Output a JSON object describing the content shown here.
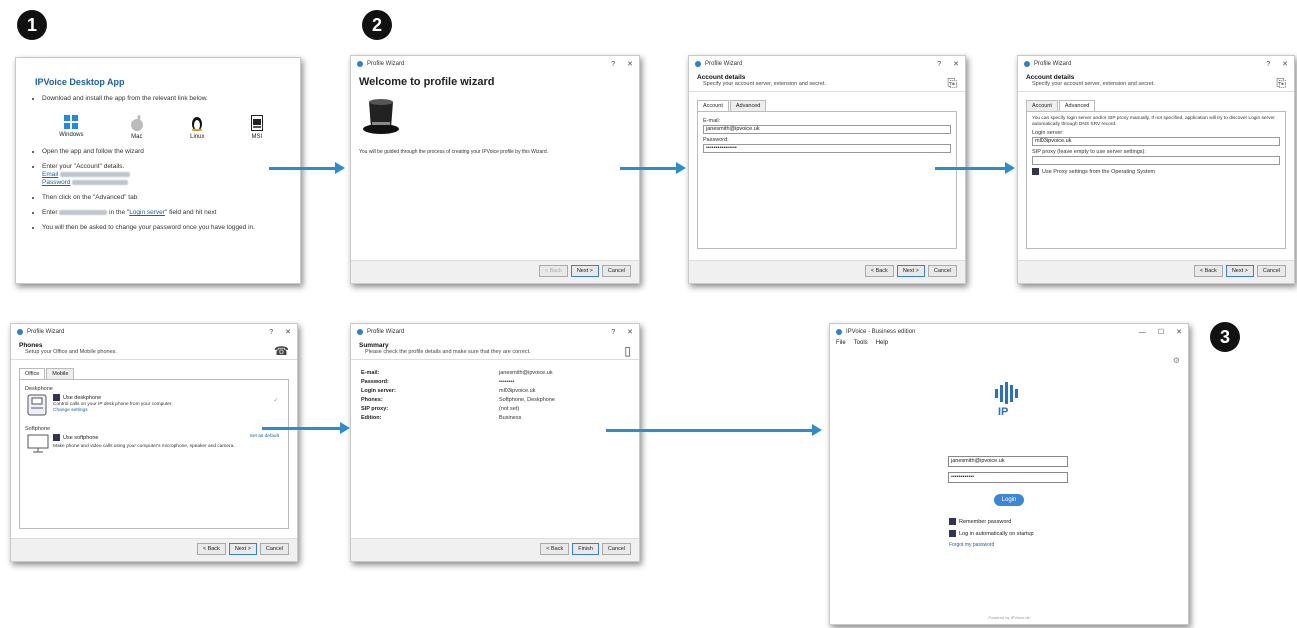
{
  "steps": [
    "1",
    "2",
    "3"
  ],
  "instructions": {
    "title": "IPVoice Desktop App",
    "download": "Download and install the app from the relevant link below.",
    "platforms": [
      "Windows",
      "Mac",
      "Linux",
      "MSI"
    ],
    "open": "Open the app and follow the wizard",
    "enter_account": "Enter your \"Account\" details.",
    "email_label": "Email",
    "password_label": "Password",
    "click_advanced": "Then click on the \"Advanced\" tab",
    "enter_prefix": "Enter",
    "enter_in": "in the \"",
    "login_server_link": "Login server",
    "enter_suffix": "\" field and hit next",
    "change_password": "You will then be asked to change your password once you have logged in."
  },
  "wizard_common": {
    "window_title": "Profile Wizard",
    "help": "?",
    "close": "✕",
    "back": "< Back",
    "next": "Next >",
    "cancel": "Cancel",
    "finish": "Finish"
  },
  "welcome": {
    "heading": "Welcome to profile wizard",
    "text": "You will be guided through the process of creating your IPVoice profile by this Wizard."
  },
  "account": {
    "title": "Account details",
    "subtitle": "Specify your account server, extension and secret.",
    "tab_account": "Account",
    "tab_advanced": "Advanced",
    "email_label": "E-mail:",
    "email_value": "janesmith@ipvoice.uk",
    "password_label": "Password:",
    "password_value": "••••••••••••••••"
  },
  "advanced": {
    "text": "You can specify login server and/or SIP proxy manually. If not specified, application will try to discover Login server automatically through DNS SRV record.",
    "login_label": "Login server:",
    "login_value": "ml03ipvoice.uk",
    "sip_label": "SIP proxy (leave empty to use server settings):",
    "proxy_check": "Use Proxy settings from the Operating System"
  },
  "phones": {
    "title": "Phones",
    "subtitle": "Setup your Office and Mobile phones.",
    "tab_office": "Office",
    "tab_mobile": "Mobile",
    "deskphone_section": "Deskphone",
    "use_deskphone": "Use deskphone",
    "deskphone_desc": "Control calls on your IP desk phone from your computer.",
    "change_settings": "Change settings",
    "softphone_section": "Softphone",
    "use_softphone": "Use softphone",
    "set_default": "Set as default",
    "softphone_desc": "Make phone and video calls using your computer's microphone, speaker and camera."
  },
  "summary": {
    "title": "Summary",
    "subtitle": "Please check the profile details and make sure that they are correct.",
    "rows": [
      {
        "k": "E-mail:",
        "v": "janesmith@ipvoice.uk"
      },
      {
        "k": "Password:",
        "v": "••••••••"
      },
      {
        "k": "Login server:",
        "v": "ml03ipvoice.uk"
      },
      {
        "k": "Phones:",
        "v": "Softphone, Deskphone"
      },
      {
        "k": "SIP proxy:",
        "v": "(not set)"
      },
      {
        "k": "Edition:",
        "v": "Business"
      }
    ]
  },
  "login_app": {
    "window_title": "IPVoice - Business edition",
    "menu": [
      "File",
      "Tools",
      "Help"
    ],
    "win_min": "—",
    "win_max": "☐",
    "win_close": "✕",
    "logo_text": "IP",
    "email_value": "janesmith@ipvoice.uk",
    "password_value": "••••••••••••",
    "login_button": "Login",
    "remember": "Remember password",
    "auto_login": "Log in automatically on startup",
    "forgot": "Forgot my password",
    "powered": "Powered by IPVoice.uk"
  },
  "colors": {
    "arrow": "#2b8dd0",
    "accent": "#2d7fd0"
  }
}
